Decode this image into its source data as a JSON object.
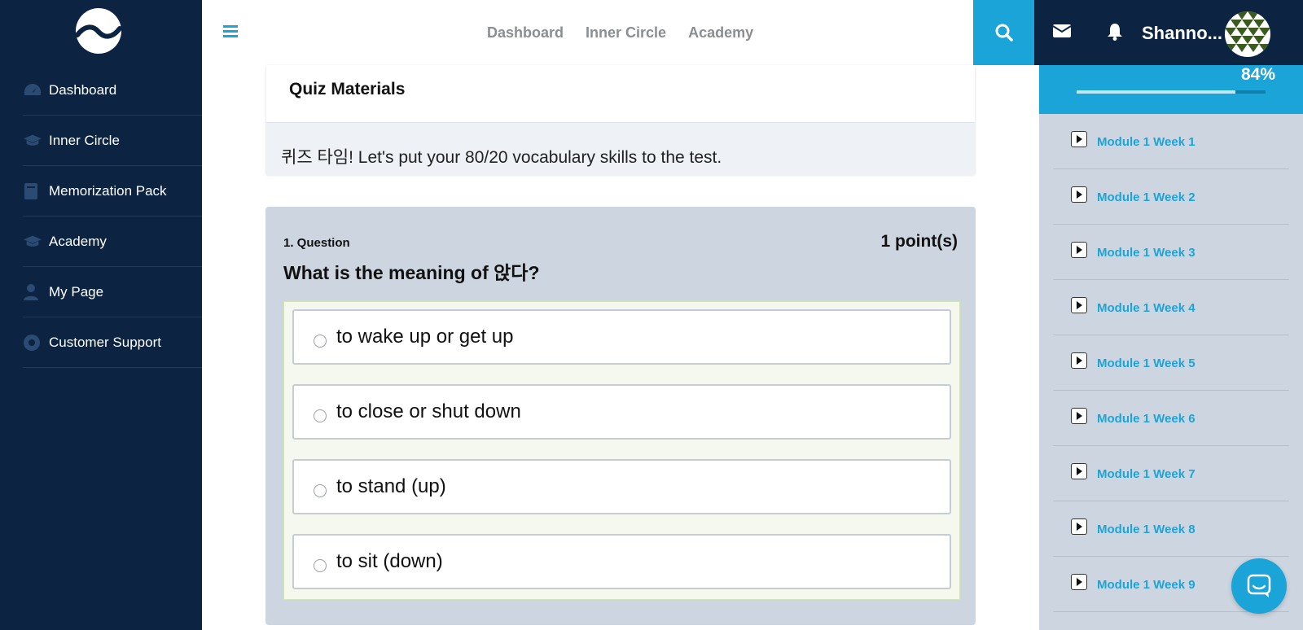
{
  "colors": {
    "sidebar_bg": "#0c2341",
    "accent": "#1aa4d8",
    "question_bg": "#cdd6e0"
  },
  "sidebar": {
    "logo_icon": "wave-logo-icon",
    "items": [
      {
        "label": "Dashboard",
        "icon": "dashboard-gauge-icon"
      },
      {
        "label": "Inner Circle",
        "icon": "graduation-cap-icon"
      },
      {
        "label": "Memorization Pack",
        "icon": "book-icon"
      },
      {
        "label": "Academy",
        "icon": "graduation-cap-icon"
      },
      {
        "label": "My Page",
        "icon": "user-icon"
      },
      {
        "label": "Customer Support",
        "icon": "life-ring-icon"
      }
    ]
  },
  "topbar": {
    "menu_icon": "hamburger-icon",
    "nav": [
      "Dashboard",
      "Inner Circle",
      "Academy"
    ],
    "search_icon": "search-icon",
    "mail_icon": "envelope-icon",
    "bell_icon": "bell-icon",
    "username": "Shanno..."
  },
  "quiz": {
    "title": "Quiz Materials",
    "intro": "퀴즈 타임! Let's put your 80/20 vocabulary skills to the test.",
    "question": {
      "number_label": "1. Question",
      "points": "1 point(s)",
      "text": "What is the meaning of 앉다?",
      "answers": [
        "to wake up or get up",
        "to close or shut down",
        "to stand (up)",
        "to sit (down)"
      ]
    }
  },
  "progress": {
    "percent_label": "84%",
    "value": 0.84
  },
  "modules": [
    "Module 1 Week 1",
    "Module 1 Week 2",
    "Module 1 Week 3",
    "Module 1 Week 4",
    "Module 1 Week 5",
    "Module 1 Week 6",
    "Module 1 Week 7",
    "Module 1 Week 8",
    "Module 1 Week 9"
  ],
  "chat_icon": "chat-messenger-icon"
}
